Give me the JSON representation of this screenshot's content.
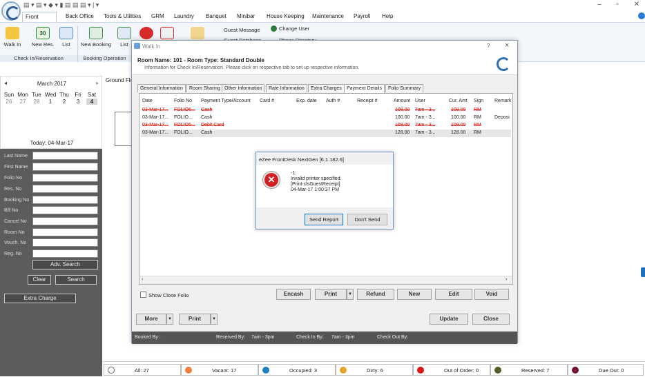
{
  "menu": {
    "tabs": [
      "Front Office",
      "Back Office",
      "Tools & Utilities",
      "GRM",
      "Laundry",
      "Banquet",
      "Minibar",
      "House Keeping",
      "Maintenance",
      "Payroll",
      "Help"
    ]
  },
  "ribbon": {
    "buttons": [
      "Walk In",
      "New Res.",
      "List",
      "New Booking",
      "List"
    ],
    "calendar_badge": "30",
    "groups": [
      "Check In/Reservation",
      "Booking Operation"
    ],
    "small_items": [
      "Guest Message",
      "Guest Database",
      "Change User",
      "Phone Directory"
    ]
  },
  "calendar": {
    "month": "March 2017",
    "days": [
      "Sun",
      "Mon",
      "Tue",
      "Wed",
      "Thu",
      "Fri",
      "Sat"
    ],
    "dates": [
      "26",
      "27",
      "28",
      "1",
      "2",
      "3",
      "4"
    ],
    "today": "Today: 04-Mar-17"
  },
  "search": {
    "labels": [
      "Last Name",
      "First Name",
      "Folio No",
      "Res. No",
      "Booking No",
      "Bill No",
      "Cancel No",
      "Room No",
      "Vouch. No",
      "Reg. No"
    ],
    "adv_search": "Adv. Search",
    "clear": "Clear",
    "search": "Search",
    "extra_charge": "Extra Charge"
  },
  "main": {
    "ground_tab": "Ground Flo"
  },
  "dialog": {
    "title": "Walk In",
    "help": "?",
    "close": "×",
    "room_title": "Room Name: 101 - Room Type: Standard Double",
    "subtitle": "Information for Check In/Reservation. Please click on respective tab to set up respective information.",
    "tabs": [
      "General Information",
      "Room Sharing",
      "Other Information",
      "Rate Information",
      "Extra Charges",
      "Payment Details",
      "Folio Summary"
    ],
    "columns": [
      "Date",
      "Folio No",
      "Payment Type/Account",
      "Card #",
      "Exp. date",
      "Auth #",
      "Receipt #",
      "Amount",
      "User",
      "Cur. Amt",
      "Sign",
      "Remark"
    ],
    "rows": [
      {
        "date": "03-Mar-17...",
        "folio": "FOLIO6...",
        "type": "Cash",
        "amount": "108.00",
        "user": "7am - 3...",
        "cur": "108.00",
        "sign": "RM",
        "remark": "",
        "cancelled": true
      },
      {
        "date": "03-Mar-17...",
        "folio": "FOLIO...",
        "type": "Cash",
        "amount": "100.00",
        "user": "7am - 3...",
        "cur": "100.00",
        "sign": "RM",
        "remark": "Deposi",
        "cancelled": false
      },
      {
        "date": "03-Mar-17...",
        "folio": "FOLIO6...",
        "type": "Debit Card",
        "amount": "108.00",
        "user": "7am - 3...",
        "cur": "108.00",
        "sign": "RM",
        "remark": "",
        "cancelled": true
      },
      {
        "date": "03-Mar-17...",
        "folio": "FOLIO...",
        "type": "Cash",
        "amount": "128.00",
        "user": "7am - 3...",
        "cur": "128.00",
        "sign": "RM",
        "remark": "",
        "cancelled": false
      }
    ],
    "show_close_folio": "Show Close Folio",
    "actions": [
      "Encash",
      "Print",
      "Refund",
      "New",
      "Edit",
      "Void"
    ],
    "more": "More",
    "print": "Print",
    "update": "Update",
    "close_btn": "Close",
    "info": {
      "booked_by": "Booked By :",
      "reserved_by": "Reserved By:",
      "reserved_by_val": "7am - 3pm",
      "check_in_by": "Check In By:",
      "check_in_by_val": "7am - 3pm",
      "check_out_by": "Check Out By:"
    }
  },
  "error": {
    "title": "eZee FrontDesk NextGen [6.1.182.6]",
    "lines": [
      "-1:",
      "Invalid printer specified.",
      "[Print-clsGuestReceipt]",
      "04-Mar-17 1:00:37 PM"
    ],
    "send_report": "Send Report",
    "dont_send": "Don't Send"
  },
  "status": [
    {
      "label": "All: 27",
      "color": "#ffffff"
    },
    {
      "label": "Vacant: 17",
      "color": "#f07f3c"
    },
    {
      "label": "Occupied: 3",
      "color": "#1f7fc4"
    },
    {
      "label": "Dirty: 6",
      "color": "#e5a52a"
    },
    {
      "label": "Out of Order: 0",
      "color": "#d91818"
    },
    {
      "label": "Reserved: 7",
      "color": "#5a5a2a"
    },
    {
      "label": "Due Out: 0",
      "color": "#7a1030"
    }
  ]
}
